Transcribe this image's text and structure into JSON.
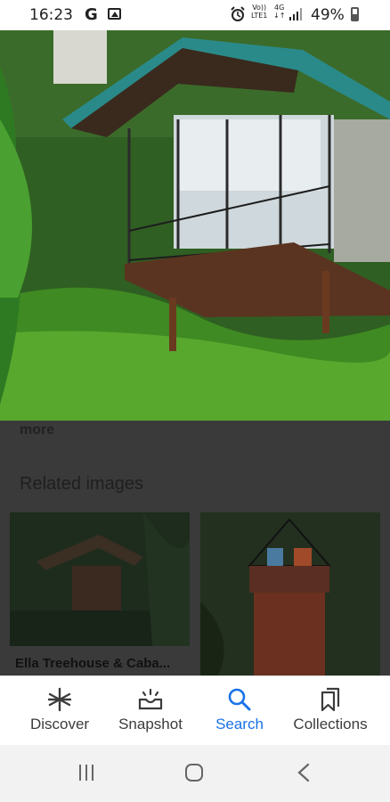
{
  "status_bar": {
    "time": "16:23",
    "g_label": "G",
    "volte_line1": "Vo))",
    "volte_line2": "LTE1",
    "net_line1": "4G",
    "net_line2": "↓↑",
    "battery": "49%"
  },
  "content": {
    "more_label": "more",
    "section_title": "Related images",
    "thumbs": [
      {
        "caption": "Ella Treehouse & Caba..."
      },
      {
        "caption": ""
      }
    ]
  },
  "tabs": [
    {
      "label": "Discover",
      "icon": "asterisk-icon"
    },
    {
      "label": "Snapshot",
      "icon": "snapshot-icon"
    },
    {
      "label": "Search",
      "icon": "search-icon"
    },
    {
      "label": "Collections",
      "icon": "bookmarks-icon"
    }
  ],
  "colors": {
    "active_tab": "#1a73e8",
    "inactive_tab": "#3c3c3c",
    "scrim": "#3a3a3a"
  }
}
